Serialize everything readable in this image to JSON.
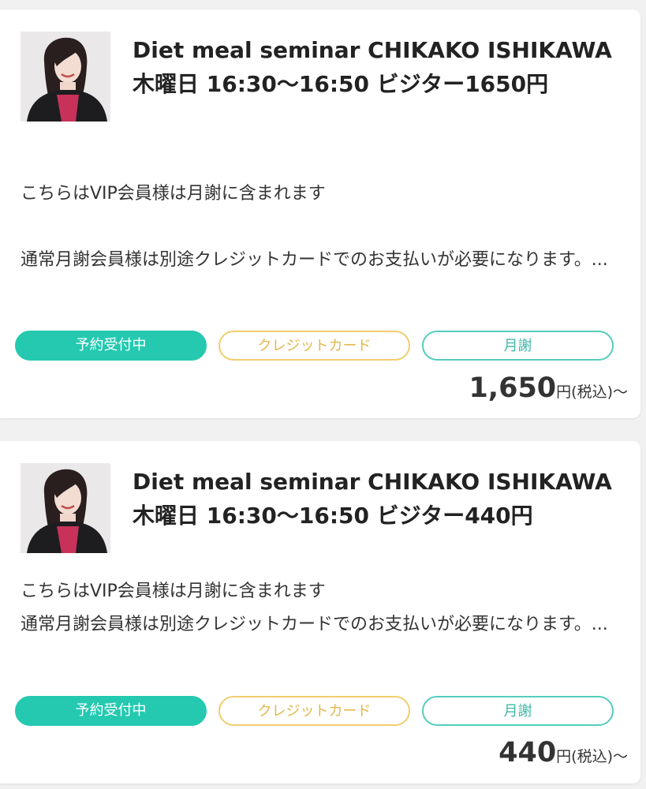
{
  "courses": [
    {
      "title": "Diet meal seminar CHIKAKO ISHIKAWA 木曜日 16:30〜16:50 ビジター1650円",
      "description_line1": "こちらはVIP会員様は月謝に含まれます",
      "description_line2": "通常月謝会員様は別途クレジットカードでのお支払いが必要になります。...",
      "tags": {
        "status": "予約受付中",
        "payment": "クレジットカード",
        "monthly": "月謝"
      },
      "price": "1,650",
      "price_unit": "円(税込)〜"
    },
    {
      "title": "Diet meal seminar CHIKAKO ISHIKAWA 木曜日 16:30〜16:50 ビジター440円",
      "description_line1": "こちらはVIP会員様は月謝に含まれます",
      "description_line2": "通常月謝会員様は別途クレジットカードでのお支払いが必要になります。...",
      "tags": {
        "status": "予約受付中",
        "payment": "クレジットカード",
        "monthly": "月謝"
      },
      "price": "440",
      "price_unit": "円(税込)〜"
    }
  ],
  "icons": {
    "thumbnail": "instructor-photo"
  },
  "colors": {
    "status_tag": "#24c9b0",
    "payment_tag": "#f1cd6e",
    "monthly_tag": "#55cdbd"
  }
}
